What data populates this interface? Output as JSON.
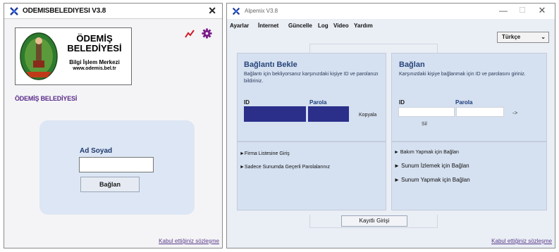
{
  "left_window": {
    "title": "ODEMISBELEDIYESI V3.8",
    "close_label": "✕",
    "logo": {
      "line1": "ÖDEMİŞ",
      "line2": "BELEDİYESİ",
      "line3": "Bilgi İşlem Merkezi",
      "line4": "www.odemis.bel.tr"
    },
    "icons": [
      "chart-icon",
      "gear-icon"
    ],
    "org_label": "ÖDEMİŞ BELEDİYESİ",
    "name_label": "Ad Soyad",
    "name_value": "",
    "connect_button": "Bağlan",
    "terms_link": "Kabul ettiğiniz sözleşme"
  },
  "right_window": {
    "title": "Alpemix V3.8",
    "controls": {
      "minimize": "—",
      "maximize": "☐",
      "close": "✕"
    },
    "menu": [
      "Ayarlar",
      "İnternet",
      "Güncelle",
      "Log",
      "Video",
      "Yardım"
    ],
    "language": "Türkçe",
    "left_panel": {
      "heading": "Bağlantı Bekle",
      "description": "Bağlantı için bekliyorsanız karşınızdaki kişiye ID ve parolanızı bildiriniz.",
      "id_label": "ID",
      "password_label": "Parola",
      "copy_label": "Kopyala",
      "links": [
        "►Firma Listesine Giriş",
        "►Sadece Sunumda Geçerli Parolalarınız"
      ]
    },
    "right_panel": {
      "heading": "Bağlan",
      "description": "Karşınızdaki kişiye bağlanmak için ID ve parolasını giriniz.",
      "id_label": "ID",
      "password_label": "Parola",
      "id_value": "",
      "password_value": "",
      "go_label": "->",
      "clear_label": "Sil",
      "links": [
        "► Bakım Yapmak için Bağlan",
        "► Sunum İzlemek için Bağlan",
        "► Sunum Yapmak için Bağlan"
      ]
    },
    "register_button": "Kayıtlı Girişi",
    "terms_link": "Kabul ettiğiniz sözleşme"
  },
  "colors": {
    "accent_dark_blue": "#2b2f8a",
    "panel_bg": "#d5e0f0",
    "heading_blue": "#27457a",
    "purple": "#5a2a8a",
    "logo_green": "#2e7a2e",
    "chart_red": "#d11a2a"
  }
}
